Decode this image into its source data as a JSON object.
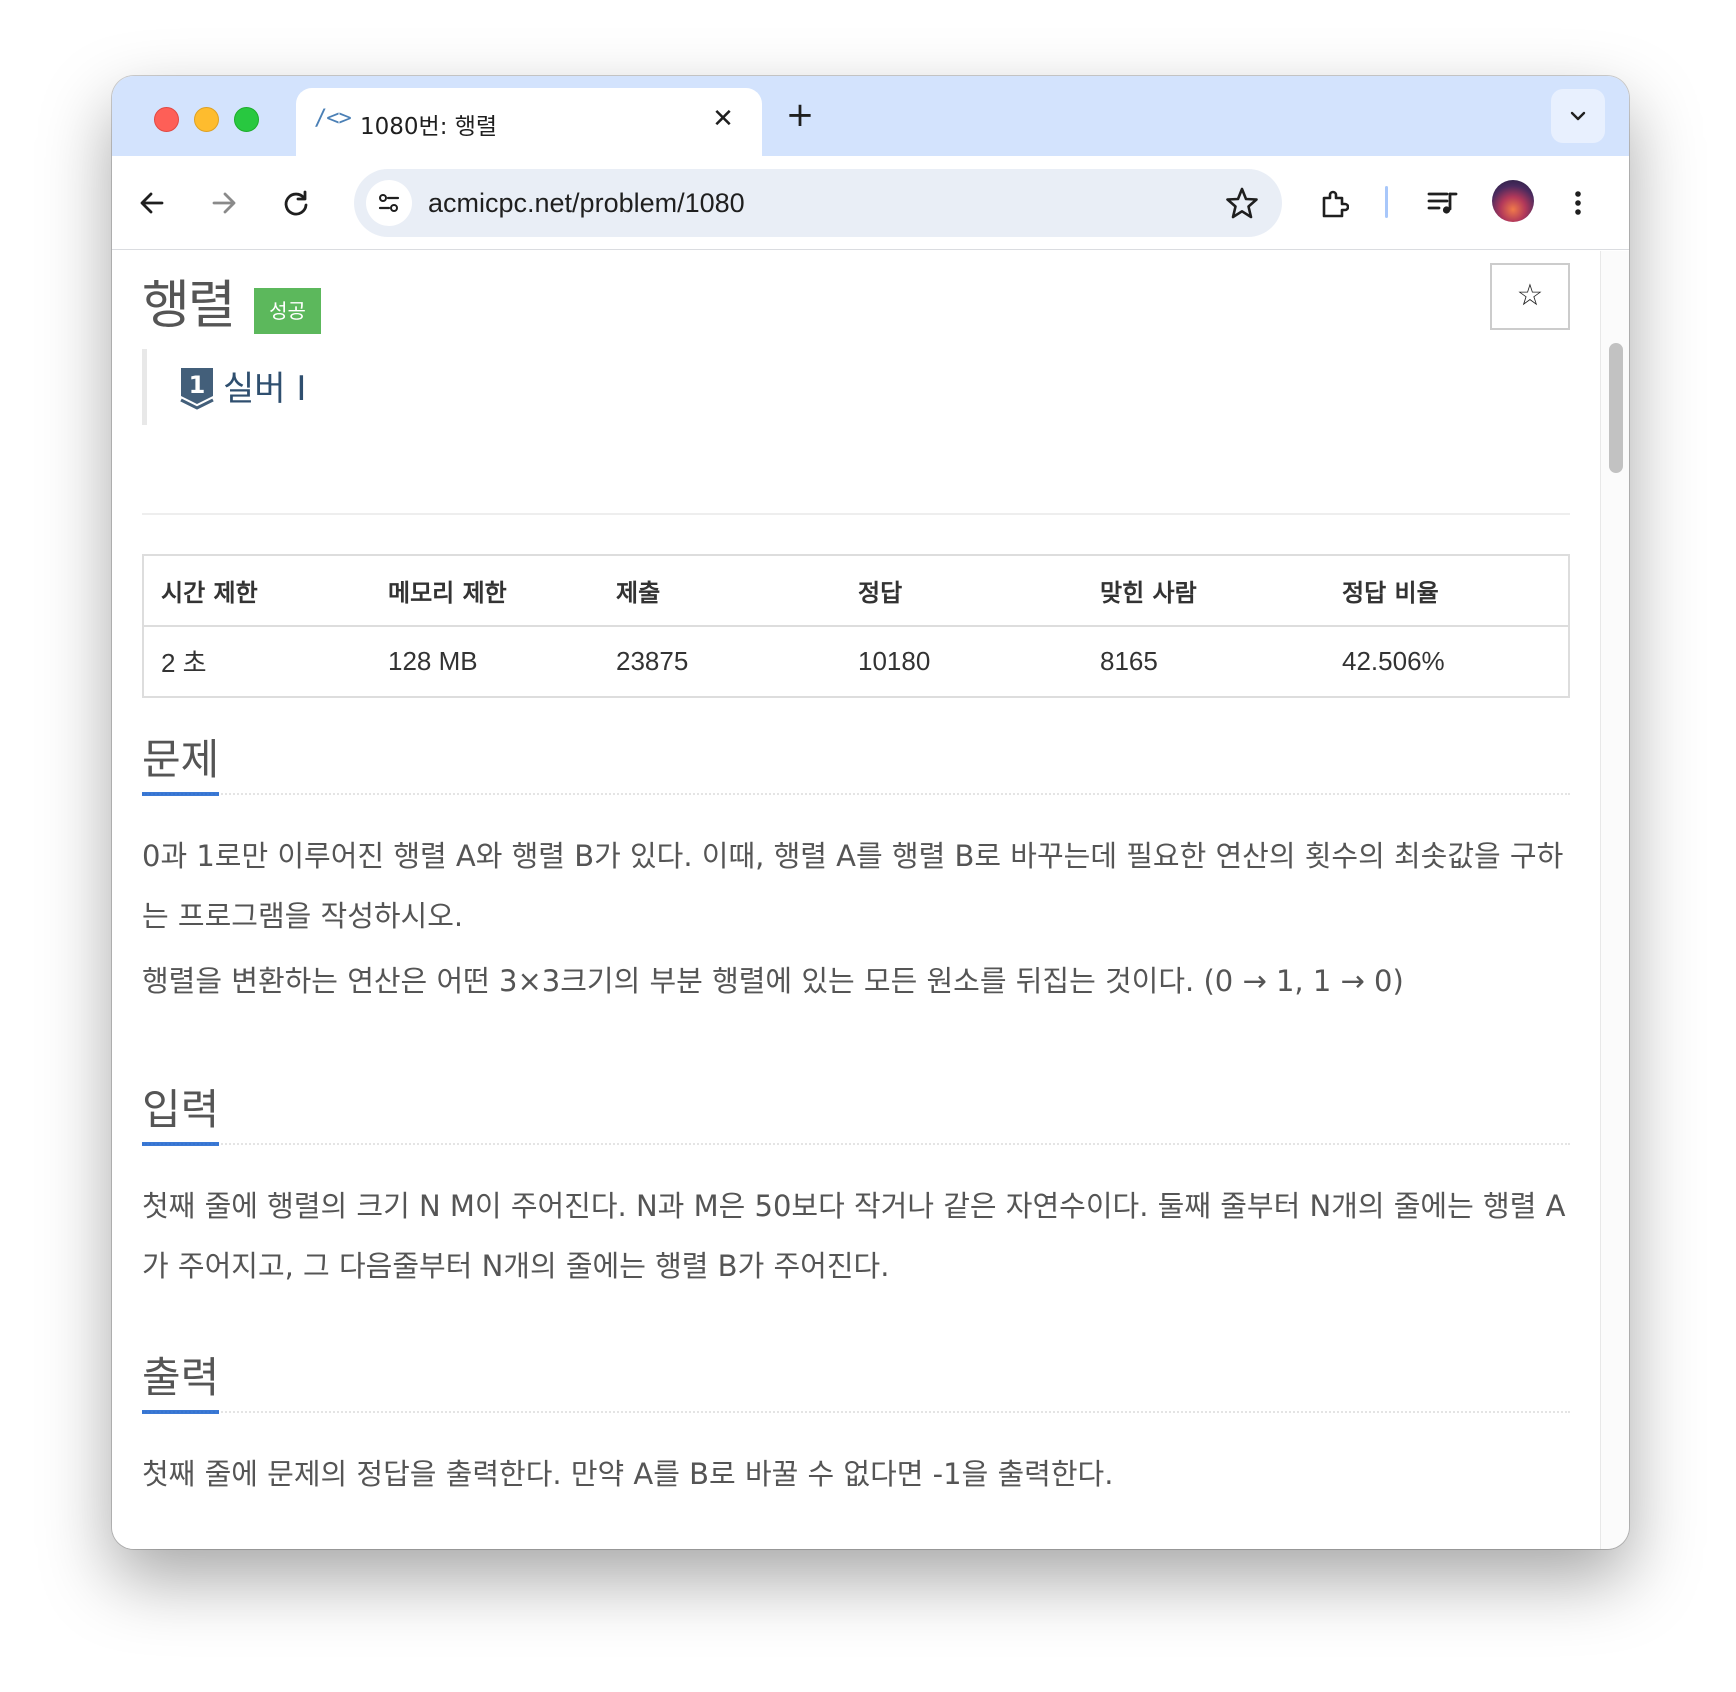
{
  "browser": {
    "tab_favicon": "/<>",
    "tab_title": "1080번: 행렬",
    "tab_close": "✕",
    "new_tab": "+",
    "url": "acmicpc.net/problem/1080"
  },
  "problem": {
    "title": "행렬",
    "result_badge": "성공",
    "bookmark": "☆",
    "tier_number": "1",
    "tier_label": "실버 I",
    "table": {
      "headers": [
        "시간 제한",
        "메모리 제한",
        "제출",
        "정답",
        "맞힌 사람",
        "정답 비율"
      ],
      "values": [
        "2 초",
        "128 MB",
        "23875",
        "10180",
        "8165",
        "42.506%"
      ]
    },
    "sections": [
      {
        "title": "문제",
        "paragraphs": [
          "0과 1로만 이루어진 행렬 A와 행렬 B가 있다. 이때, 행렬 A를 행렬 B로 바꾸는데 필요한 연산의 횟수의 최솟값을 구하는 프로그램을 작성하시오.",
          "행렬을 변환하는 연산은 어떤 3×3크기의 부분 행렬에 있는 모든 원소를 뒤집는 것이다. (0 → 1, 1 → 0)"
        ]
      },
      {
        "title": "입력",
        "paragraphs": [
          "첫째 줄에 행렬의 크기 N M이 주어진다. N과 M은 50보다 작거나 같은 자연수이다. 둘째 줄부터 N개의 줄에는 행렬 A가 주어지고, 그 다음줄부터 N개의 줄에는 행렬 B가 주어진다."
        ]
      },
      {
        "title": "출력",
        "paragraphs": [
          "첫째 줄에 문제의 정답을 출력한다. 만약 A를 B로 바꿀 수 없다면 -1을 출력한다."
        ]
      }
    ]
  },
  "icons": {
    "back": "arrow-left-icon",
    "forward": "arrow-right-icon",
    "reload": "reload-icon",
    "site_info": "tune-icon",
    "bookmark_star": "star-icon",
    "extensions": "puzzle-icon",
    "media": "playlist-icon",
    "menu": "kebab-menu-icon"
  }
}
